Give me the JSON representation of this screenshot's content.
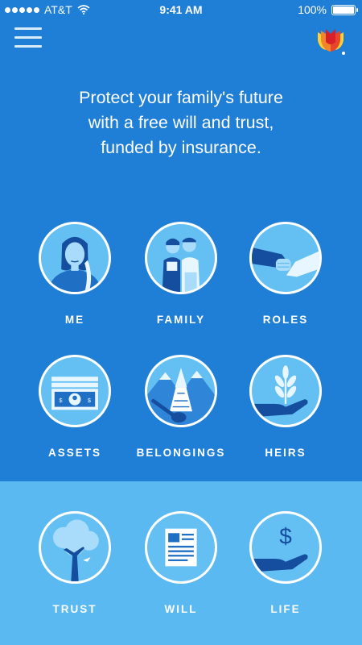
{
  "status_bar": {
    "carrier": "AT&T",
    "time": "9:41 AM",
    "battery": "100%"
  },
  "header": {
    "menu_icon": "hamburger-icon",
    "logo_icon": "tulip-logo-icon"
  },
  "headline": "Protect your family's future\nwith a free will and trust,\nfunded by insurance.",
  "grid": [
    {
      "label": "ME",
      "icon": "person-icon"
    },
    {
      "label": "FAMILY",
      "icon": "family-icon"
    },
    {
      "label": "ROLES",
      "icon": "handshake-icon"
    },
    {
      "label": "ASSETS",
      "icon": "money-icon"
    },
    {
      "label": "BELONGINGS",
      "icon": "guitar-icon"
    },
    {
      "label": "HEIRS",
      "icon": "sprout-hand-icon"
    }
  ],
  "bottom": [
    {
      "label": "TRUST",
      "icon": "tree-icon"
    },
    {
      "label": "WILL",
      "icon": "document-icon"
    },
    {
      "label": "LIFE",
      "icon": "dollar-hand-icon"
    }
  ],
  "colors": {
    "primary": "#1f7ed6",
    "light": "#5bb9f2",
    "navy": "#0f3f86",
    "circle_fill": "#64c0f3"
  }
}
